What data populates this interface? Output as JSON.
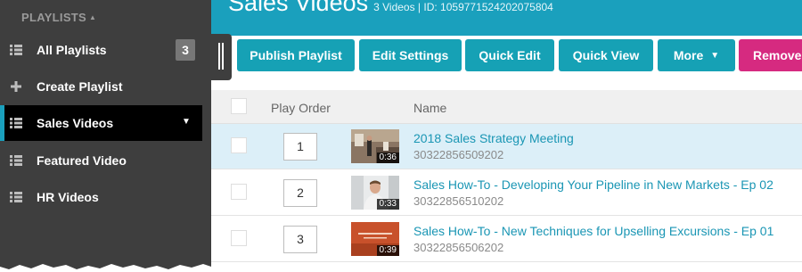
{
  "colors": {
    "accent": "#1aa0bd",
    "danger": "#d62a80",
    "sidebar": "#3e3e3e",
    "selected_row": "#dceff8"
  },
  "header": {
    "title": "Sales Videos",
    "meta": "3 Videos | ID: 1059771524202075804"
  },
  "sidebar": {
    "heading": "PLAYLISTS",
    "items": [
      {
        "label": "All Playlists",
        "icon": "list-icon",
        "badge": "3"
      },
      {
        "label": "Create Playlist",
        "icon": "plus-icon"
      },
      {
        "label": "Sales Videos",
        "icon": "list-icon",
        "active": true
      },
      {
        "label": "Featured Video",
        "icon": "list-icon"
      },
      {
        "label": "HR Videos",
        "icon": "list-icon"
      }
    ]
  },
  "toolbar": {
    "publish": "Publish Playlist",
    "edit_settings": "Edit Settings",
    "quick_edit": "Quick Edit",
    "quick_view": "Quick View",
    "more": "More",
    "remove": "Remove"
  },
  "table": {
    "columns": {
      "play_order": "Play Order",
      "name": "Name"
    },
    "rows": [
      {
        "order": "1",
        "name": "2018 Sales Strategy Meeting",
        "id": "30322856509202",
        "duration": "0:36",
        "selected": true
      },
      {
        "order": "2",
        "name": "Sales How-To - Developing Your Pipeline in New Markets - Ep 02",
        "id": "30322856510202",
        "duration": "0:33"
      },
      {
        "order": "3",
        "name": "Sales How-To - New Techniques for Upselling Excursions - Ep 01",
        "id": "30322856506202",
        "duration": "0:39"
      }
    ]
  }
}
